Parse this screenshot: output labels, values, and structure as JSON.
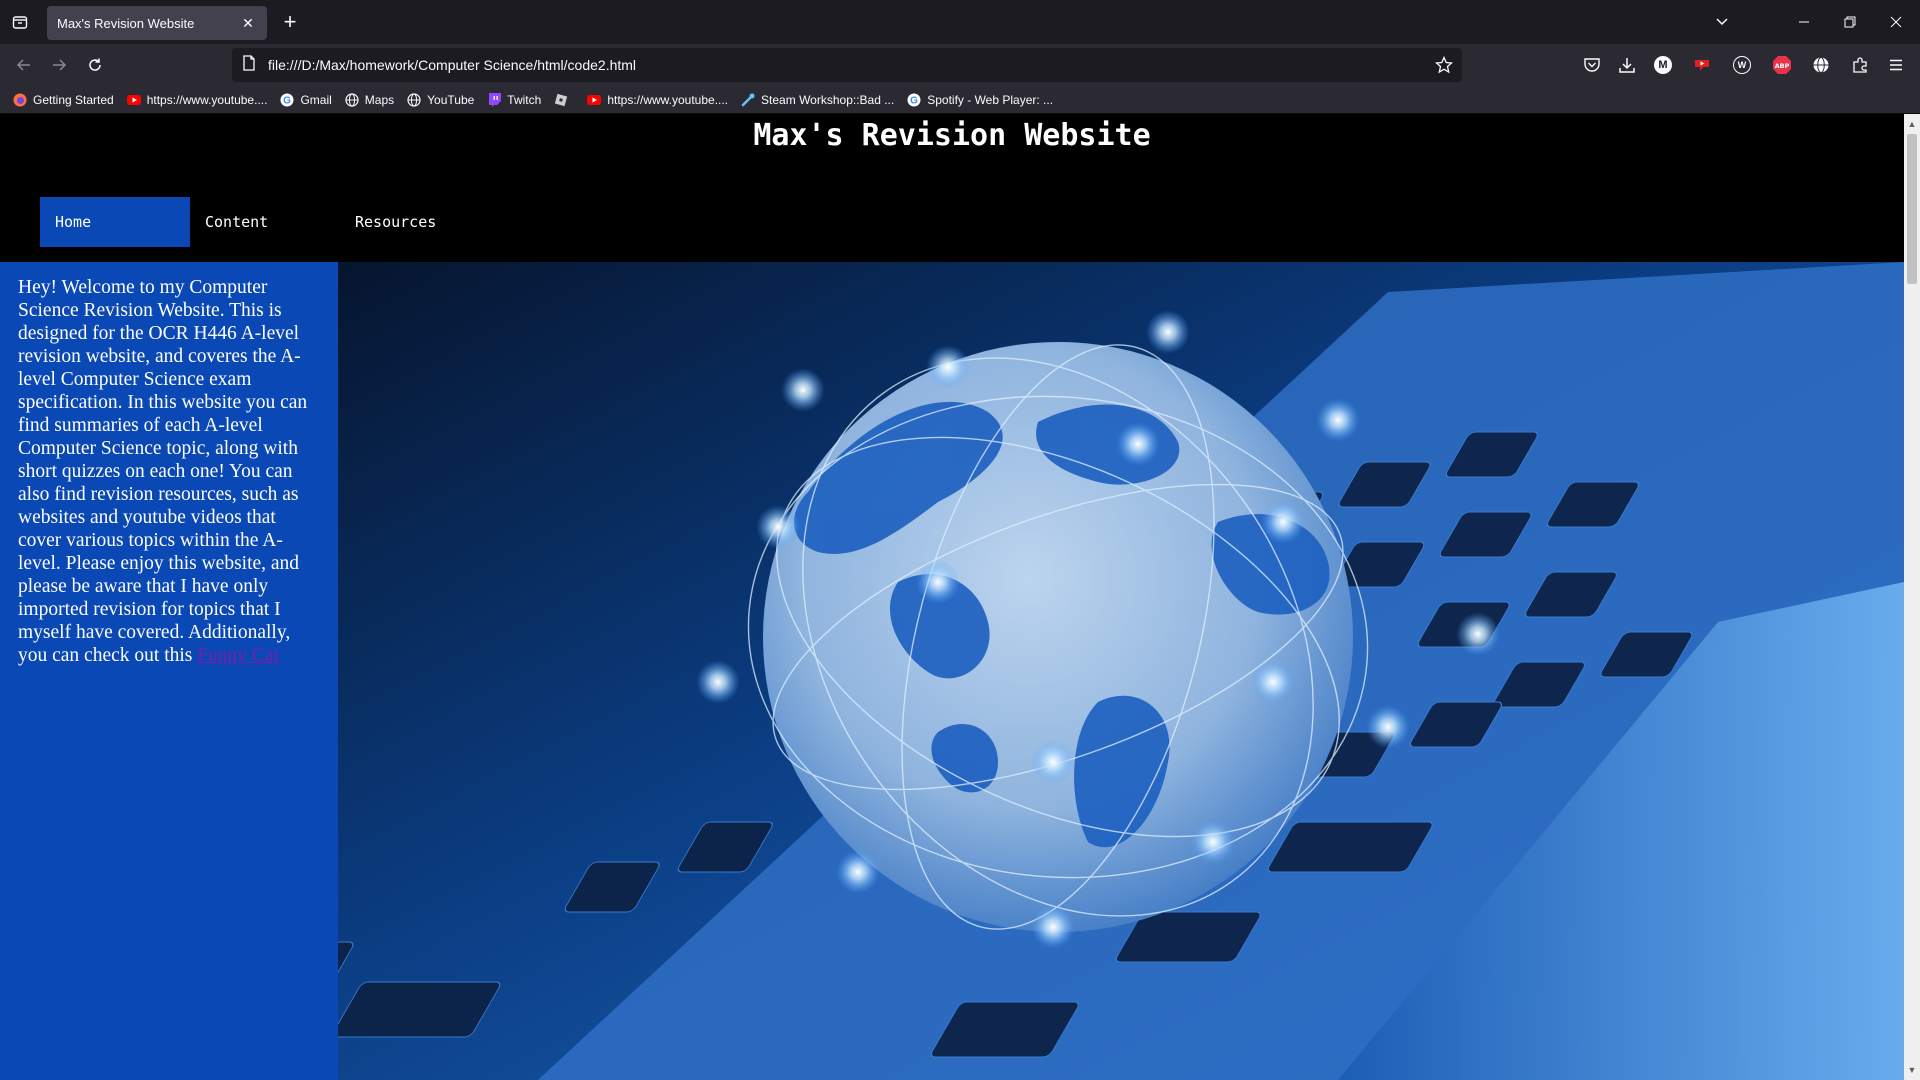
{
  "browser": {
    "tab_title": "Max's Revision Website",
    "url": "file:///D:/Max/homework/Computer Science/html/code2.html",
    "bookmarks": [
      {
        "label": "Getting Started",
        "icon": "firefox-icon"
      },
      {
        "label": "https://www.youtube....",
        "icon": "youtube-icon"
      },
      {
        "label": "Gmail",
        "icon": "google-icon"
      },
      {
        "label": "Maps",
        "icon": "globe-icon"
      },
      {
        "label": "YouTube",
        "icon": "globe-icon"
      },
      {
        "label": "Twitch",
        "icon": "twitch-icon"
      },
      {
        "label": "",
        "icon": "roblox-icon"
      },
      {
        "label": "https://www.youtube....",
        "icon": "youtube-icon"
      },
      {
        "label": "Steam Workshop::Bad ...",
        "icon": "steam-icon"
      },
      {
        "label": "Spotify - Web Player: ...",
        "icon": "google-icon"
      }
    ]
  },
  "site": {
    "title": "Max's Revision Website",
    "nav": [
      {
        "label": "Home",
        "active": true
      },
      {
        "label": "Content",
        "active": false
      },
      {
        "label": "Resources",
        "active": false
      }
    ],
    "intro_text": "Hey! Welcome to my Computer Science Revision Website. This is designed for the OCR H446 A-level revision website, and coveres the A-level Computer Science exam specification. In this website you can find summaries of each A-level Computer Science topic, along with short quizzes on each one! You can also find revision resources, such as websites and youtube videos that cover various topics within the A-level. Please enjoy this website, and please be aware that I have only imported revision for topics that I myself have covered. Additionally, you can check out this ",
    "intro_link": "Funny Cat",
    "hero_image": "laptop-globe-image"
  },
  "colors": {
    "site_accent": "#0a48b6",
    "link": "#7a1ea8"
  }
}
